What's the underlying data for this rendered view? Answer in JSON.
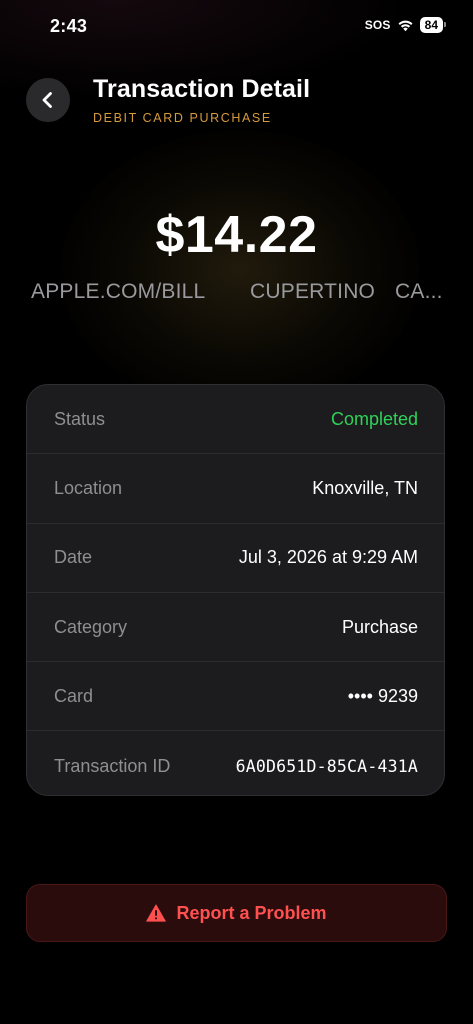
{
  "status_bar": {
    "time": "2:43",
    "sos": "SOS",
    "battery": "84"
  },
  "header": {
    "title": "Transaction Detail",
    "subtitle": "DEBIT CARD PURCHASE"
  },
  "transaction": {
    "amount": "$14.22",
    "merchant_name": "APPLE.COM/BILL",
    "merchant_city": "CUPERTINO",
    "merchant_state_truncated": "CA..."
  },
  "details": [
    {
      "label": "Status",
      "value": "Completed"
    },
    {
      "label": "Location",
      "value": "Knoxville, TN"
    },
    {
      "label": "Date",
      "value": "Jul 3, 2026 at 9:29 AM"
    },
    {
      "label": "Category",
      "value": "Purchase"
    },
    {
      "label": "Card",
      "value": "•••• 9239"
    },
    {
      "label": "Transaction ID",
      "value": "6A0D651D-85CA-431A"
    }
  ],
  "report_button": {
    "label": "Report a Problem"
  },
  "colors": {
    "accent_subtitle": "#d69a3c",
    "status_completed": "#30d158",
    "danger": "#ff5050"
  },
  "icons": {
    "back": "chevron-left-icon",
    "wifi": "wifi-icon",
    "warning": "warning-triangle-icon"
  }
}
